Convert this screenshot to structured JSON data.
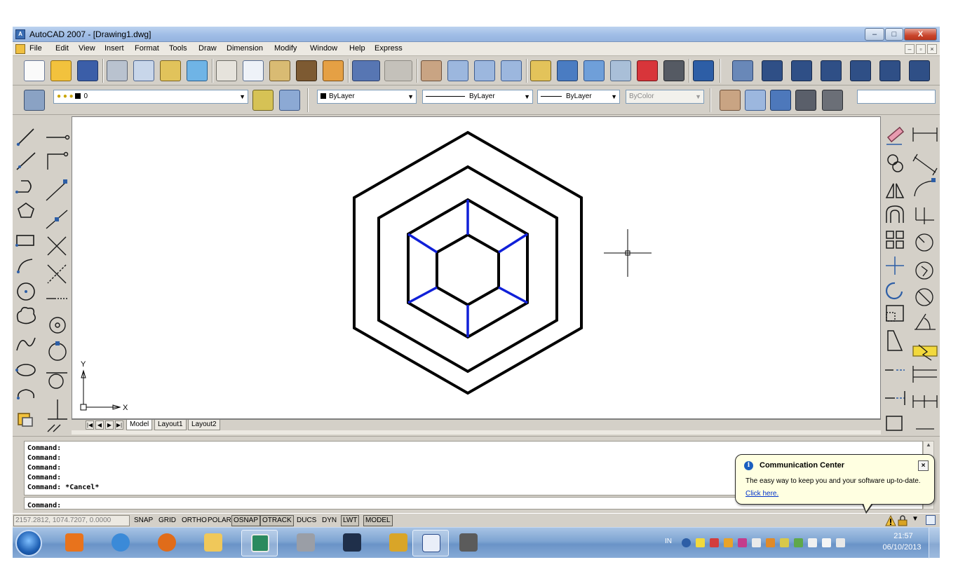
{
  "window": {
    "title": "AutoCAD 2007 - [Drawing1.dwg]",
    "caption_buttons": {
      "minimize": "–",
      "maximize": "□",
      "close": "X"
    }
  },
  "menubar": {
    "items": [
      "File",
      "Edit",
      "View",
      "Insert",
      "Format",
      "Tools",
      "Draw",
      "Dimension",
      "Modify",
      "Window",
      "Help",
      "Express"
    ],
    "mdi_buttons": [
      "–",
      "▫",
      "×"
    ]
  },
  "toolbar2": {
    "layer_combo": "0",
    "color_combo": "ByLayer",
    "linetype_combo": "ByLayer",
    "lineweight_combo": "ByLayer",
    "plotstyle_combo": "ByColor"
  },
  "ucs": {
    "x_label": "X",
    "y_label": "Y"
  },
  "layout_tabs": [
    "Model",
    "Layout1",
    "Layout2"
  ],
  "layout_nav": [
    "|◀",
    "◀",
    "▶",
    "▶|"
  ],
  "command": {
    "history": [
      "Command:",
      "Command:",
      "Command:",
      "Command:",
      "Command: *Cancel*"
    ],
    "prompt": "Command:"
  },
  "status": {
    "coordinates": "2157.2812, 1074.7207, 0.0000",
    "toggles": [
      {
        "label": "SNAP",
        "on": false
      },
      {
        "label": "GRID",
        "on": false
      },
      {
        "label": "ORTHO",
        "on": false
      },
      {
        "label": "POLAR",
        "on": false
      },
      {
        "label": "OSNAP",
        "on": true
      },
      {
        "label": "OTRACK",
        "on": true
      },
      {
        "label": "DUCS",
        "on": false
      },
      {
        "label": "DYN",
        "on": false
      },
      {
        "label": "LWT",
        "on": true
      },
      {
        "label": "MODEL",
        "on": true
      }
    ]
  },
  "communication_center": {
    "title": "Communication Center",
    "message": "The easy way to keep you and your software up-to-date.",
    "link": "Click here.",
    "close": "×"
  },
  "taskbar": {
    "tray_lang": "IN",
    "clock_time": "21:57",
    "clock_date": "06/10/2013"
  },
  "colors": {
    "drawing_lines": "#000000",
    "highlight_lines": "#1020d8",
    "window_chrome": "#d4d0c8",
    "taskbar": "#7ea4d2",
    "balloon_bg": "#ffffe1"
  },
  "icons": {
    "toolbar1": [
      "new-icon",
      "open-icon",
      "save-icon",
      "plot-icon",
      "plot-preview-icon",
      "publish-icon",
      "3d-dwf-icon",
      "cut-icon",
      "copy-icon",
      "paste-icon",
      "match-properties-icon",
      "block-editor-icon",
      "undo-icon",
      "redo-icon",
      "pan-icon",
      "zoom-realtime-icon",
      "zoom-window-icon",
      "zoom-previous-icon",
      "properties-icon",
      "design-center-icon",
      "tool-palettes-icon",
      "sheet-set-icon",
      "markup-icon",
      "calculator-icon",
      "help-icon",
      "3d-view-icon",
      "top-view-icon",
      "bottom-view-icon",
      "left-view-icon",
      "right-view-icon",
      "front-view-icon",
      "back-view-icon"
    ],
    "toolbar2": [
      "layer-manager-icon",
      "make-current-icon",
      "layer-previous-icon",
      "pan-realtime-icon",
      "zoom-realtime-icon",
      "orbit-icon",
      "camera-icon",
      "walk-icon"
    ],
    "draw_tools": [
      "line-icon",
      "construction-line-icon",
      "polyline-icon",
      "polygon-icon",
      "rectangle-icon",
      "arc-icon",
      "circle-icon",
      "revision-cloud-icon",
      "spline-icon",
      "ellipse-icon",
      "ellipse-arc-icon",
      "insert-block-icon"
    ],
    "object_snap_tools": [
      "temp-track-icon",
      "snap-from-icon",
      "snap-endpoint-icon",
      "snap-midpoint-icon",
      "snap-intersection-icon",
      "snap-apparent-intersection-icon",
      "snap-extension-icon",
      "snap-center-icon",
      "snap-quadrant-icon",
      "snap-tangent-icon",
      "snap-perpendicular-icon",
      "snap-parallel-icon"
    ],
    "modify_tools": [
      "erase-icon",
      "copy-object-icon",
      "mirror-icon",
      "offset-icon",
      "array-icon",
      "move-icon",
      "rotate-icon",
      "scale-icon",
      "stretch-icon",
      "trim-icon",
      "extend-icon",
      "break-icon"
    ],
    "dimension_tools": [
      "linear-dim-icon",
      "aligned-dim-icon",
      "arc-length-icon",
      "ordinate-icon",
      "radius-icon",
      "jogged-icon",
      "diameter-icon",
      "angular-icon",
      "quick-dim-icon",
      "baseline-icon",
      "continue-icon",
      "dim-space-icon"
    ]
  }
}
